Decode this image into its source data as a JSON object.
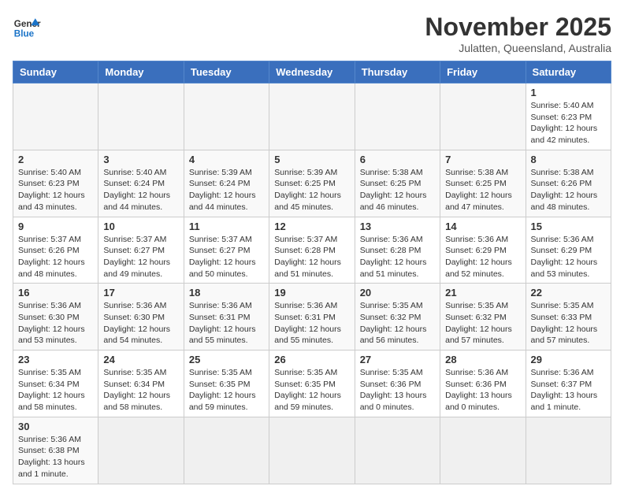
{
  "logo": {
    "text_general": "General",
    "text_blue": "Blue"
  },
  "title": "November 2025",
  "subtitle": "Julatten, Queensland, Australia",
  "weekdays": [
    "Sunday",
    "Monday",
    "Tuesday",
    "Wednesday",
    "Thursday",
    "Friday",
    "Saturday"
  ],
  "weeks": [
    [
      {
        "day": "",
        "info": ""
      },
      {
        "day": "",
        "info": ""
      },
      {
        "day": "",
        "info": ""
      },
      {
        "day": "",
        "info": ""
      },
      {
        "day": "",
        "info": ""
      },
      {
        "day": "",
        "info": ""
      },
      {
        "day": "1",
        "info": "Sunrise: 5:40 AM\nSunset: 6:23 PM\nDaylight: 12 hours and 42 minutes."
      }
    ],
    [
      {
        "day": "2",
        "info": "Sunrise: 5:40 AM\nSunset: 6:23 PM\nDaylight: 12 hours and 43 minutes."
      },
      {
        "day": "3",
        "info": "Sunrise: 5:40 AM\nSunset: 6:24 PM\nDaylight: 12 hours and 44 minutes."
      },
      {
        "day": "4",
        "info": "Sunrise: 5:39 AM\nSunset: 6:24 PM\nDaylight: 12 hours and 44 minutes."
      },
      {
        "day": "5",
        "info": "Sunrise: 5:39 AM\nSunset: 6:25 PM\nDaylight: 12 hours and 45 minutes."
      },
      {
        "day": "6",
        "info": "Sunrise: 5:38 AM\nSunset: 6:25 PM\nDaylight: 12 hours and 46 minutes."
      },
      {
        "day": "7",
        "info": "Sunrise: 5:38 AM\nSunset: 6:25 PM\nDaylight: 12 hours and 47 minutes."
      },
      {
        "day": "8",
        "info": "Sunrise: 5:38 AM\nSunset: 6:26 PM\nDaylight: 12 hours and 48 minutes."
      }
    ],
    [
      {
        "day": "9",
        "info": "Sunrise: 5:37 AM\nSunset: 6:26 PM\nDaylight: 12 hours and 48 minutes."
      },
      {
        "day": "10",
        "info": "Sunrise: 5:37 AM\nSunset: 6:27 PM\nDaylight: 12 hours and 49 minutes."
      },
      {
        "day": "11",
        "info": "Sunrise: 5:37 AM\nSunset: 6:27 PM\nDaylight: 12 hours and 50 minutes."
      },
      {
        "day": "12",
        "info": "Sunrise: 5:37 AM\nSunset: 6:28 PM\nDaylight: 12 hours and 51 minutes."
      },
      {
        "day": "13",
        "info": "Sunrise: 5:36 AM\nSunset: 6:28 PM\nDaylight: 12 hours and 51 minutes."
      },
      {
        "day": "14",
        "info": "Sunrise: 5:36 AM\nSunset: 6:29 PM\nDaylight: 12 hours and 52 minutes."
      },
      {
        "day": "15",
        "info": "Sunrise: 5:36 AM\nSunset: 6:29 PM\nDaylight: 12 hours and 53 minutes."
      }
    ],
    [
      {
        "day": "16",
        "info": "Sunrise: 5:36 AM\nSunset: 6:30 PM\nDaylight: 12 hours and 53 minutes."
      },
      {
        "day": "17",
        "info": "Sunrise: 5:36 AM\nSunset: 6:30 PM\nDaylight: 12 hours and 54 minutes."
      },
      {
        "day": "18",
        "info": "Sunrise: 5:36 AM\nSunset: 6:31 PM\nDaylight: 12 hours and 55 minutes."
      },
      {
        "day": "19",
        "info": "Sunrise: 5:36 AM\nSunset: 6:31 PM\nDaylight: 12 hours and 55 minutes."
      },
      {
        "day": "20",
        "info": "Sunrise: 5:35 AM\nSunset: 6:32 PM\nDaylight: 12 hours and 56 minutes."
      },
      {
        "day": "21",
        "info": "Sunrise: 5:35 AM\nSunset: 6:32 PM\nDaylight: 12 hours and 57 minutes."
      },
      {
        "day": "22",
        "info": "Sunrise: 5:35 AM\nSunset: 6:33 PM\nDaylight: 12 hours and 57 minutes."
      }
    ],
    [
      {
        "day": "23",
        "info": "Sunrise: 5:35 AM\nSunset: 6:34 PM\nDaylight: 12 hours and 58 minutes."
      },
      {
        "day": "24",
        "info": "Sunrise: 5:35 AM\nSunset: 6:34 PM\nDaylight: 12 hours and 58 minutes."
      },
      {
        "day": "25",
        "info": "Sunrise: 5:35 AM\nSunset: 6:35 PM\nDaylight: 12 hours and 59 minutes."
      },
      {
        "day": "26",
        "info": "Sunrise: 5:35 AM\nSunset: 6:35 PM\nDaylight: 12 hours and 59 minutes."
      },
      {
        "day": "27",
        "info": "Sunrise: 5:35 AM\nSunset: 6:36 PM\nDaylight: 13 hours and 0 minutes."
      },
      {
        "day": "28",
        "info": "Sunrise: 5:36 AM\nSunset: 6:36 PM\nDaylight: 13 hours and 0 minutes."
      },
      {
        "day": "29",
        "info": "Sunrise: 5:36 AM\nSunset: 6:37 PM\nDaylight: 13 hours and 1 minute."
      }
    ],
    [
      {
        "day": "30",
        "info": "Sunrise: 5:36 AM\nSunset: 6:38 PM\nDaylight: 13 hours and 1 minute."
      },
      {
        "day": "",
        "info": ""
      },
      {
        "day": "",
        "info": ""
      },
      {
        "day": "",
        "info": ""
      },
      {
        "day": "",
        "info": ""
      },
      {
        "day": "",
        "info": ""
      },
      {
        "day": "",
        "info": ""
      }
    ]
  ]
}
